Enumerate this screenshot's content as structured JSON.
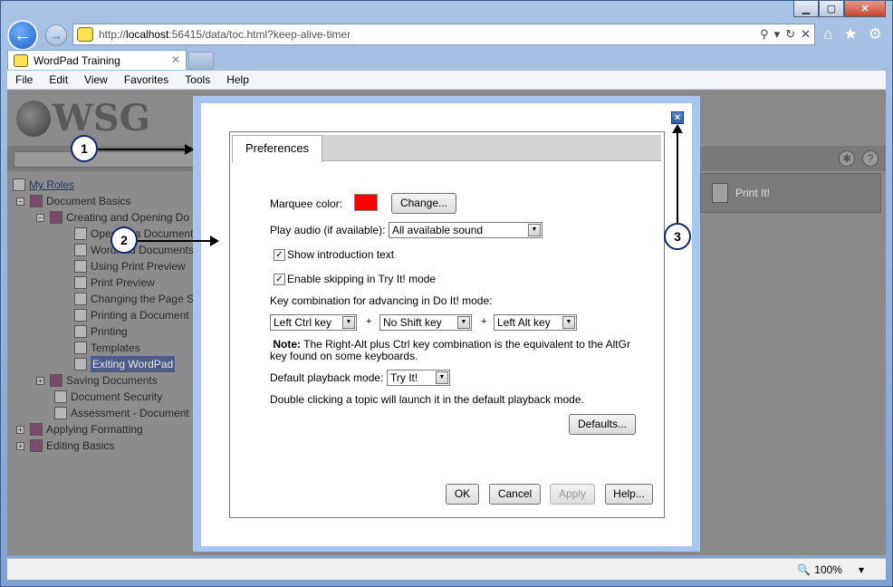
{
  "browser": {
    "url_prefix": "http://",
    "url_host": "localhost",
    "url_rest": ":56415/data/toc.html?keep-alive-timer",
    "tab_title": "WordPad Training",
    "menu": [
      "File",
      "Edit",
      "View",
      "Favorites",
      "Tools",
      "Help"
    ],
    "zoom": "100%"
  },
  "app": {
    "logo_text": "WSG",
    "my_roles": "My Roles",
    "print_it": "Print It!",
    "toc": [
      {
        "label": "Document Basics",
        "icon": "book-open"
      },
      {
        "label": "Creating and Opening Do",
        "icon": "book-open"
      },
      {
        "label": "Opening a Document",
        "icon": "page"
      },
      {
        "label": "WordPad Documents",
        "icon": "help-page"
      },
      {
        "label": "Using Print Preview",
        "icon": "page"
      },
      {
        "label": "Print Preview",
        "icon": "help-page"
      },
      {
        "label": "Changing the Page S",
        "icon": "page"
      },
      {
        "label": "Printing a Document",
        "icon": "page"
      },
      {
        "label": "Printing",
        "icon": "help-page"
      },
      {
        "label": "Templates",
        "icon": "doc"
      },
      {
        "label": "Exiting WordPad",
        "icon": "page"
      },
      {
        "label": "Saving Documents",
        "icon": "book"
      },
      {
        "label": "Document Security",
        "icon": "doc"
      },
      {
        "label": "Assessment - Document I",
        "icon": "help-page"
      },
      {
        "label": "Applying Formatting",
        "icon": "book"
      },
      {
        "label": "Editing Basics",
        "icon": "book"
      }
    ]
  },
  "callouts": [
    "1",
    "2",
    "3"
  ],
  "dialog": {
    "tab": "Preferences",
    "marquee_label": "Marquee color:",
    "marquee_color": "#ff0000",
    "change_button": "Change...",
    "play_audio_label": "Play audio (if available):",
    "play_audio_value": "All available sound",
    "show_intro": "Show introduction text",
    "enable_skip": "Enable skipping in Try It! mode",
    "key_combo_label": "Key combination for advancing in Do It! mode:",
    "key1": "Left Ctrl key",
    "key2": "No Shift key",
    "key3": "Left Alt key",
    "plus": "+",
    "note_bold": "Note:",
    "note_text": " The Right-Alt plus Ctrl key combination is the equivalent to the AltGr key found on some keyboards.",
    "default_mode_label": "Default playback mode:",
    "default_mode_value": "Try It!",
    "double_click_text": "Double clicking a topic will launch it in the default playback mode.",
    "defaults_button": "Defaults...",
    "ok": "OK",
    "cancel": "Cancel",
    "apply": "Apply",
    "help": "Help...",
    "close": "×"
  }
}
